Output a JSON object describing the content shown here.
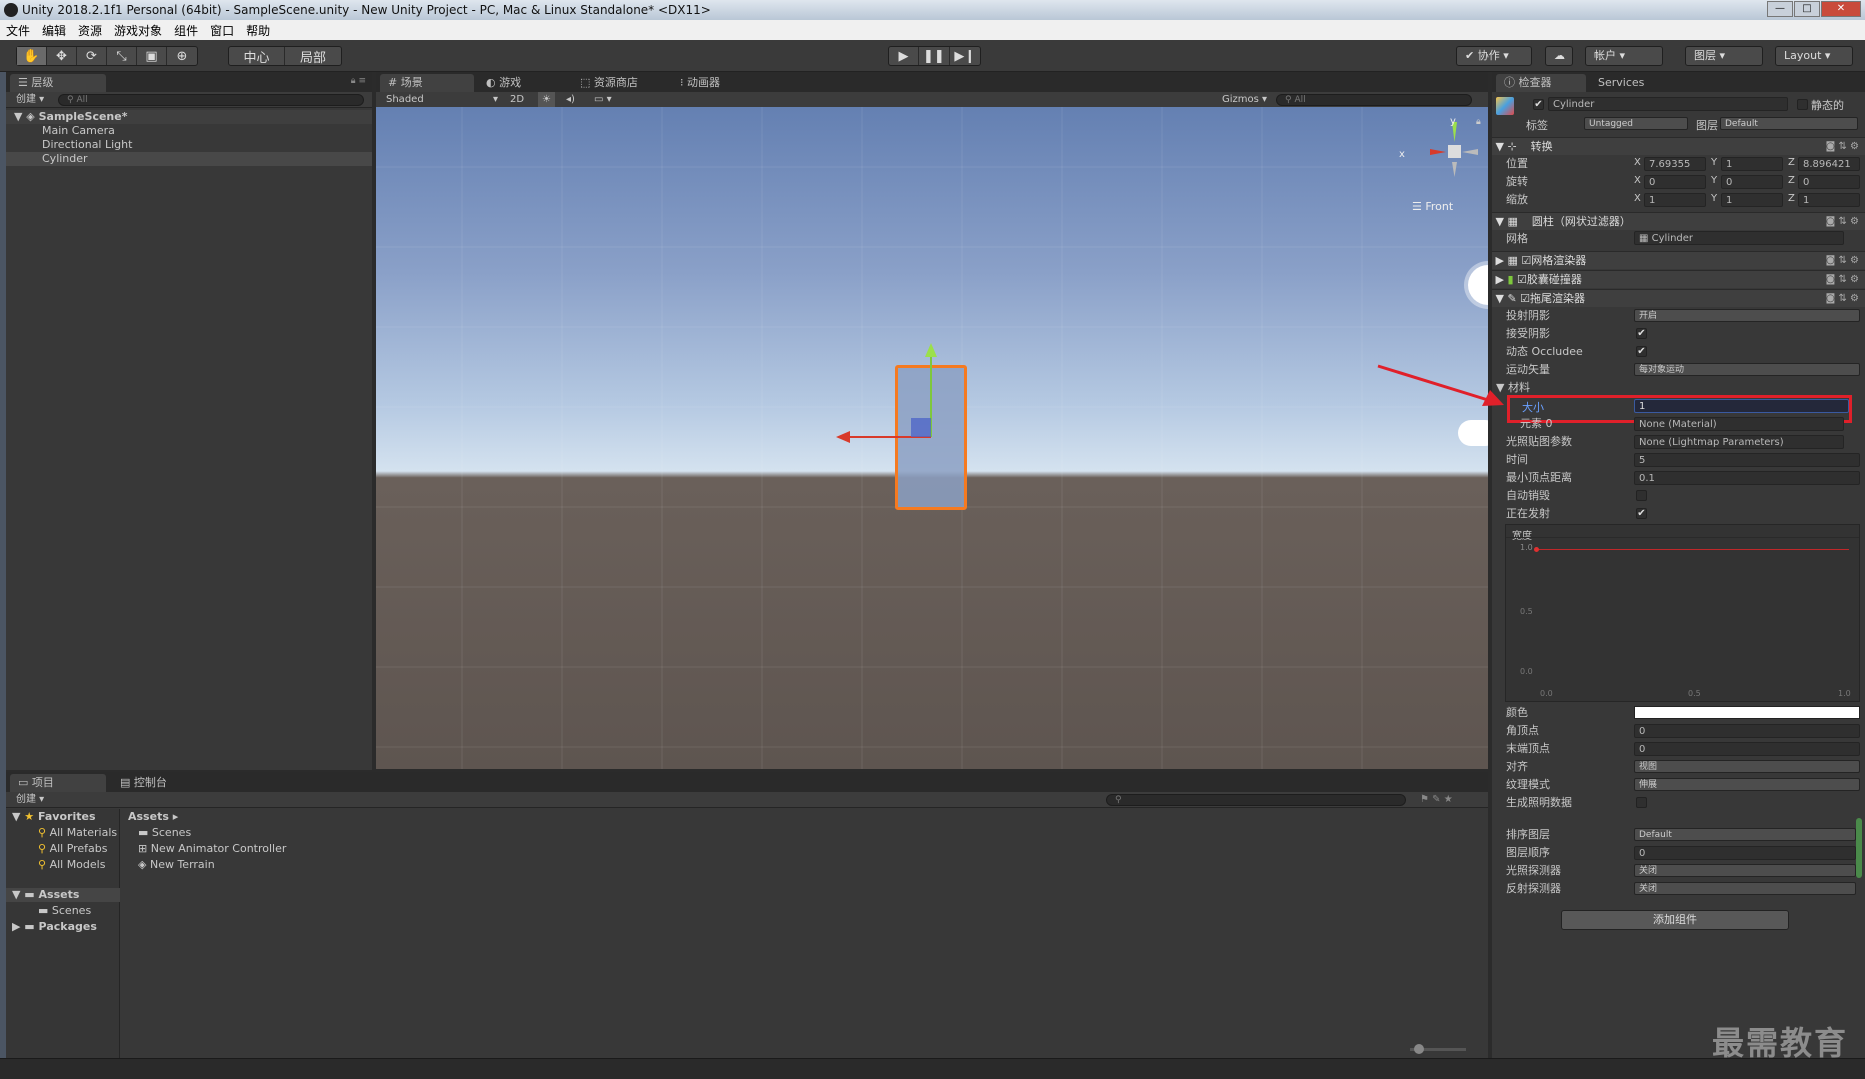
{
  "window": {
    "title": "Unity 2018.2.1f1 Personal (64bit) - SampleScene.unity - New Unity Project - PC, Mac & Linux Standalone* <DX11>"
  },
  "menu": [
    "文件",
    "编辑",
    "资源",
    "游戏对象",
    "组件",
    "窗口",
    "帮助"
  ],
  "toolbar": {
    "pivot_center": "中心",
    "pivot_local": "局部",
    "collab": "协作",
    "account": "帐户",
    "layers": "图层",
    "layout": "Layout"
  },
  "hierarchy": {
    "tab": "层级",
    "create": "创建",
    "search_placeholder": "All",
    "scene": "SampleScene*",
    "items": [
      "Main Camera",
      "Directional Light",
      "Cylinder"
    ]
  },
  "scene": {
    "tabs": [
      "场景",
      "游戏",
      "资源商店",
      "动画器"
    ],
    "shading": "Shaded",
    "mode2d": "2D",
    "gizmos": "Gizmos",
    "search_placeholder": "All",
    "view_label": "Front",
    "axes": {
      "x": "x",
      "y": "y"
    }
  },
  "inspector": {
    "tabs": [
      "检查器",
      "Services"
    ],
    "object_name": "Cylinder",
    "static": "静态的",
    "tag_label": "标签",
    "tag": "Untagged",
    "layer_label": "图层",
    "layer": "Default",
    "transform": {
      "title": "转换",
      "position_label": "位置",
      "rotation_label": "旋转",
      "scale_label": "缩放",
      "position": {
        "x": "7.69355",
        "y": "1",
        "z": "8.896421"
      },
      "rotation": {
        "x": "0",
        "y": "0",
        "z": "0"
      },
      "scale": {
        "x": "1",
        "y": "1",
        "z": "1"
      }
    },
    "mesh_filter": {
      "title": "圆柱（网状过滤器）",
      "mesh_label": "网格",
      "mesh": "Cylinder"
    },
    "mesh_renderer": "网格渲染器",
    "capsule_collider": "胶囊碰撞器",
    "trail_renderer": {
      "title": "拖尾渲染器",
      "cast_shadows_label": "投射阴影",
      "cast_shadows": "开启",
      "receive_shadows_label": "接受阴影",
      "dynamic_occluded_label": "动态 Occludee",
      "motion_vectors_label": "运动矢量",
      "motion_vectors": "每对象运动",
      "materials_label": "材料",
      "size_label": "大小",
      "size": "1",
      "element0_label": "元素 0",
      "element0": "None (Material)",
      "lightmap_params_label": "光照贴图参数",
      "lightmap_params": "None (Lightmap Parameters)",
      "time_label": "时间",
      "time": "5",
      "min_vertex_label": "最小顶点距离",
      "min_vertex": "0.1",
      "autodestruct_label": "自动销毁",
      "emitting_label": "正在发射",
      "width_label": "宽度",
      "curve_y": [
        "1.0",
        "0.5",
        "0.0"
      ],
      "curve_x": [
        "0.0",
        "0.5",
        "1.0"
      ],
      "color_label": "颜色",
      "corner_vertices_label": "角顶点",
      "corner_vertices": "0",
      "end_cap_label": "末端顶点",
      "end_cap": "0",
      "alignment_label": "对齐",
      "alignment": "视图",
      "texture_mode_label": "纹理模式",
      "texture_mode": "伸展",
      "gen_lighting_label": "生成照明数据",
      "sorting_layer_label": "排序图层",
      "sorting_layer": "Default",
      "order_label": "图层顺序",
      "order": "0",
      "light_probes_label": "光照探测器",
      "light_probes": "关闭",
      "reflection_probes_label": "反射探测器",
      "reflection_probes": "关闭"
    },
    "add_component": "添加组件"
  },
  "project": {
    "tabs": [
      "项目",
      "控制台"
    ],
    "create": "创建",
    "favorites": "Favorites",
    "fav_items": [
      "All Materials",
      "All Prefabs",
      "All Models"
    ],
    "assets_label": "Assets",
    "scenes": "Scenes",
    "packages": "Packages",
    "breadcrumb": "Assets",
    "asset_items": [
      "Scenes",
      "New Animator Controller",
      "New Terrain"
    ]
  },
  "watermark": "最需教育",
  "colors": {
    "selection": "#f57a20",
    "highlight_box": "#e0202a",
    "arrow": "#e0202a"
  }
}
